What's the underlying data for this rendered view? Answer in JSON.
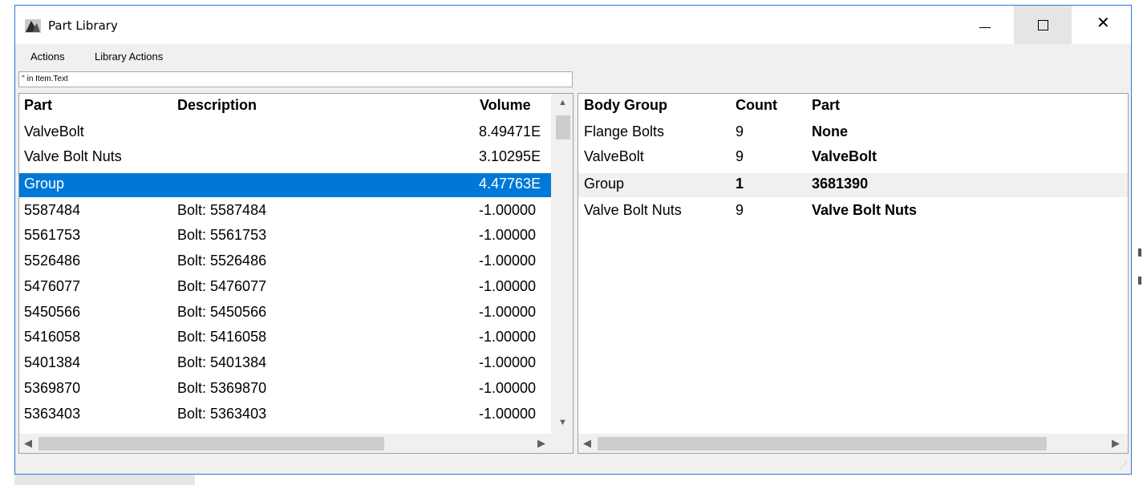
{
  "window": {
    "title": "Part Library",
    "controls": {
      "minimize": "—",
      "maximize": "",
      "close": "✕"
    }
  },
  "menu": [
    "Actions",
    "Library Actions"
  ],
  "filter": {
    "value": "'' in Item.Text"
  },
  "left_table": {
    "columns": [
      "Part",
      "Description",
      "Volume"
    ],
    "rows": [
      {
        "part": "ValveBolt",
        "description": "",
        "volume": "8.49471E"
      },
      {
        "part": "Valve Bolt Nuts",
        "description": "",
        "volume": "3.10295E"
      },
      {
        "part": "Group",
        "description": "",
        "volume": "4.47763E",
        "selected": true
      },
      {
        "part": "5587484",
        "description": "Bolt: 5587484",
        "volume": "-1.00000"
      },
      {
        "part": "5561753",
        "description": "Bolt: 5561753",
        "volume": "-1.00000"
      },
      {
        "part": "5526486",
        "description": "Bolt: 5526486",
        "volume": "-1.00000"
      },
      {
        "part": "5476077",
        "description": "Bolt: 5476077",
        "volume": "-1.00000"
      },
      {
        "part": "5450566",
        "description": "Bolt: 5450566",
        "volume": "-1.00000"
      },
      {
        "part": "5416058",
        "description": "Bolt: 5416058",
        "volume": "-1.00000"
      },
      {
        "part": "5401384",
        "description": "Bolt: 5401384",
        "volume": "-1.00000"
      },
      {
        "part": "5369870",
        "description": "Bolt: 5369870",
        "volume": "-1.00000"
      },
      {
        "part": "5363403",
        "description": "Bolt: 5363403",
        "volume": "-1.00000"
      }
    ]
  },
  "right_table": {
    "columns": [
      "Body Group",
      "Count",
      "Part"
    ],
    "rows": [
      {
        "body_group": "Flange Bolts",
        "count": "9",
        "part": "None"
      },
      {
        "body_group": "ValveBolt",
        "count": "9",
        "part": "ValveBolt"
      },
      {
        "body_group": "Group",
        "count": "1",
        "part": "3681390",
        "highlighted": true
      },
      {
        "body_group": "Valve Bolt Nuts",
        "count": "9",
        "part": "Valve Bolt Nuts"
      }
    ]
  },
  "icons": {
    "app": "part-library-icon",
    "scroll_up": "▲",
    "scroll_down": "▼",
    "scroll_left": "◀",
    "scroll_right": "▶",
    "resize_grip": "resize-grip-icon"
  },
  "colors": {
    "selection": "#0078d7",
    "window_border": "#2b79d9"
  }
}
